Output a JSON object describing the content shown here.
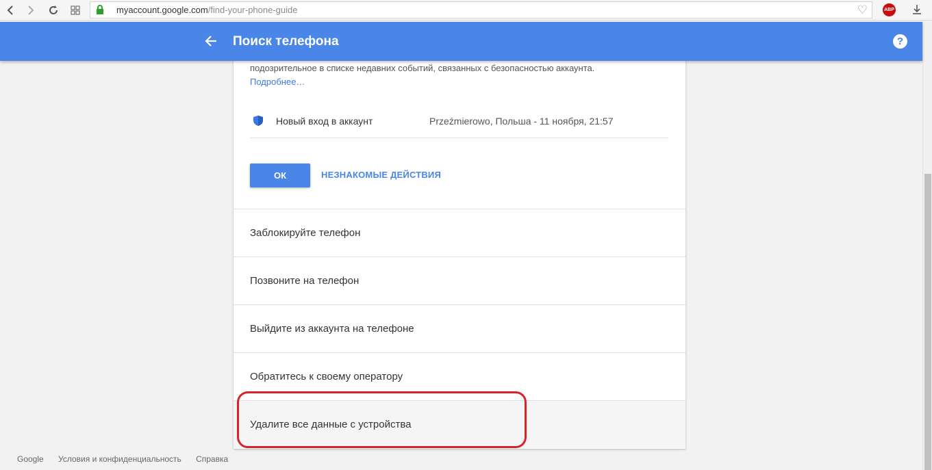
{
  "browser": {
    "url_domain": "myaccount.google.com",
    "url_path": "/find-your-phone-guide",
    "abp_label": "ABP"
  },
  "header": {
    "title": "Поиск телефона",
    "help_label": "?"
  },
  "card": {
    "intro_text": "подозрительное в списке недавних событий, связанных с безопасностью аккаунта.",
    "more_link": "Подробнее…",
    "event": {
      "name": "Новый вход в аккаунт",
      "detail": "Przeźmierowo, Польша - 11 ноября, 21:57"
    },
    "ok_label": "ОК",
    "unknown_activity_label": "НЕЗНАКОМЫЕ ДЕЙСТВИЯ"
  },
  "actions": [
    {
      "label": "Заблокируйте телефон"
    },
    {
      "label": "Позвоните на телефон"
    },
    {
      "label": "Выйдите из аккаунта на телефоне"
    },
    {
      "label": "Обратитесь к своему оператору"
    },
    {
      "label": "Удалите все данные с устройства"
    }
  ],
  "footer": {
    "google": "Google",
    "terms": "Условия и конфиденциальность",
    "help": "Справка"
  },
  "colors": {
    "header_blue": "#4a86e8",
    "link_blue": "#3b78e7",
    "highlight_red": "#d8232a"
  }
}
